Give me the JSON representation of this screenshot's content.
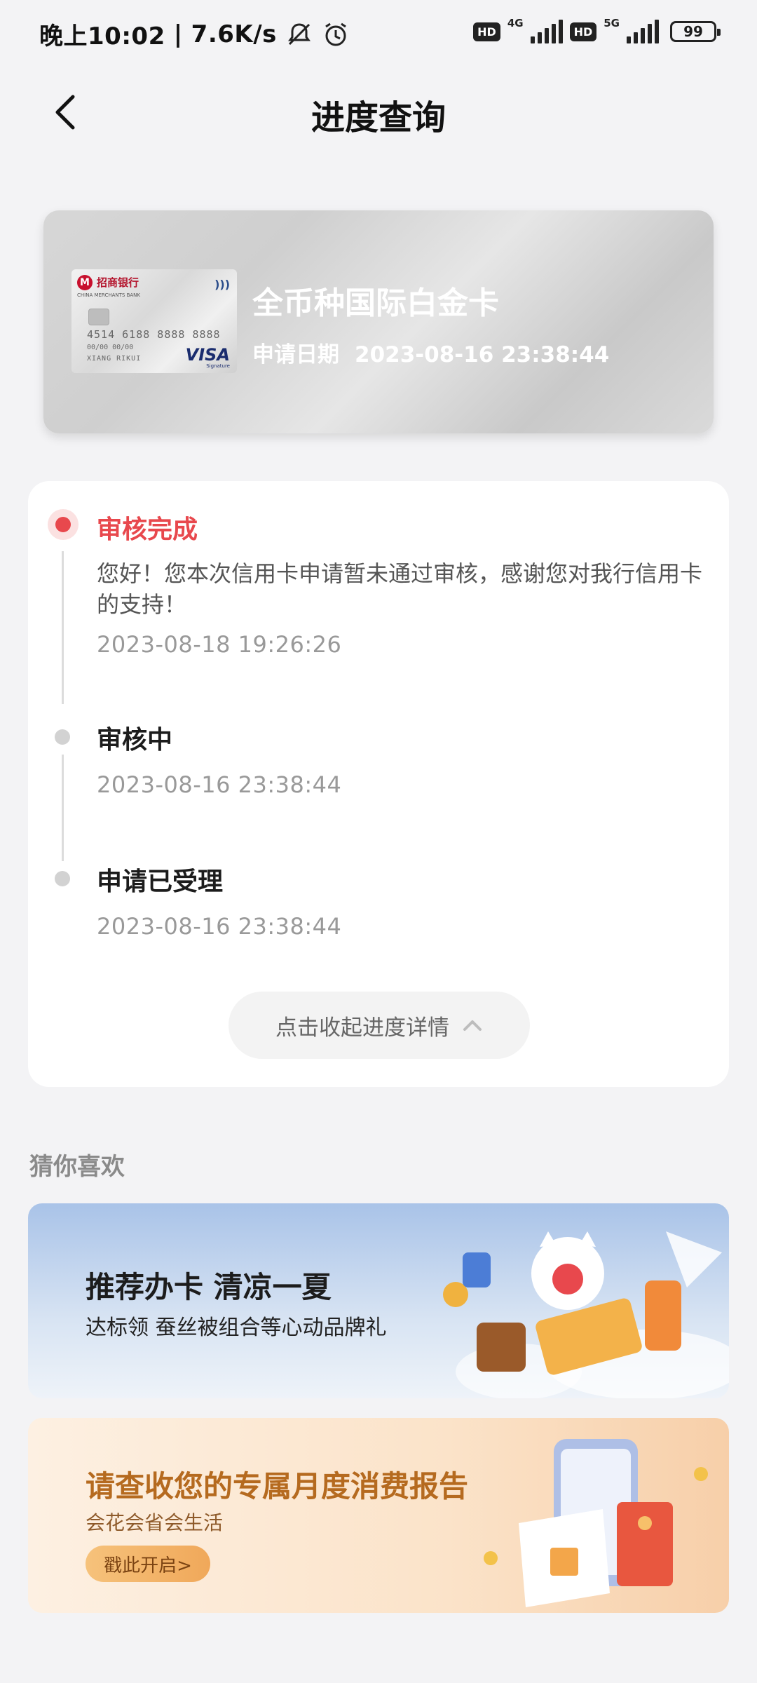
{
  "status_bar": {
    "time": "晚上10:02",
    "net_speed": "7.6K/s",
    "hd1": "HD",
    "net1": "4G",
    "hd2": "HD",
    "net2": "5G",
    "battery": "99"
  },
  "header": {
    "title": "进度查询"
  },
  "card": {
    "bank_name": "招商银行",
    "bank_sub": "CHINA MERCHANTS BANK",
    "number": "4514 6188 8888 8888",
    "expiry": "00/00   00/00",
    "holder": "XIANG RIKUI",
    "network": "VISA",
    "network_sub": "Signature",
    "name": "全币种国际白金卡",
    "date_label": "申请日期",
    "date_value": "2023-08-16 23:38:44"
  },
  "progress": {
    "steps": [
      {
        "title": "审核完成",
        "desc": "您好！您本次信用卡申请暂未通过审核，感谢您对我行信用卡的支持！",
        "time": "2023-08-18 19:26:26"
      },
      {
        "title": "审核中",
        "time": "2023-08-16 23:38:44"
      },
      {
        "title": "申请已受理",
        "time": "2023-08-16 23:38:44"
      }
    ],
    "collapse_label": "点击收起进度详情"
  },
  "recommend": {
    "section_title": "猜你喜欢",
    "banners": [
      {
        "title": "推荐办卡 清凉一夏",
        "subtitle": "达标领 蚕丝被组合等心动品牌礼"
      },
      {
        "title": "请查收您的专属月度消费报告",
        "subtitle": "会花会省会生活",
        "button": "戳此开启>"
      }
    ]
  },
  "colors": {
    "accent_red": "#e8484d",
    "card_silver": "#d3d3d3",
    "banner_orange": "#b56a1f"
  }
}
